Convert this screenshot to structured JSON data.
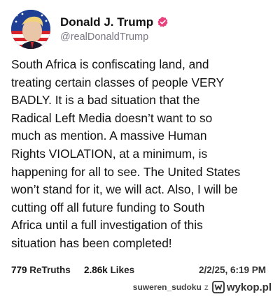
{
  "author": {
    "display_name": "Donald J. Trump",
    "handle": "@realDonaldTrump",
    "verified_color": "#e8417c",
    "avatar_icon": "avatar-flag-portrait"
  },
  "post": {
    "text": "South Africa is confiscating land, and\ntreating certain classes of people VERY\nBADLY. It is a bad situation that the\nRadical Left Media doesn’t want to so\nmuch as mention. A massive Human\nRights VIOLATION, at a minimum, is\nhappening for all to see. The United States\nwon’t stand for it, we will act. Also, I will be\ncutting off all future funding to South\nAfrica until a full investigation of this\nsituation has been completed!"
  },
  "stats": {
    "retruths_count": "779",
    "retruths_label": "ReTruths",
    "likes_count": "2.86k",
    "likes_label": "Likes",
    "timestamp": "2/2/25, 6:19 PM"
  },
  "watermark": {
    "user": "suweren_sudoku",
    "separator": "z",
    "site": "wykop.pl"
  }
}
